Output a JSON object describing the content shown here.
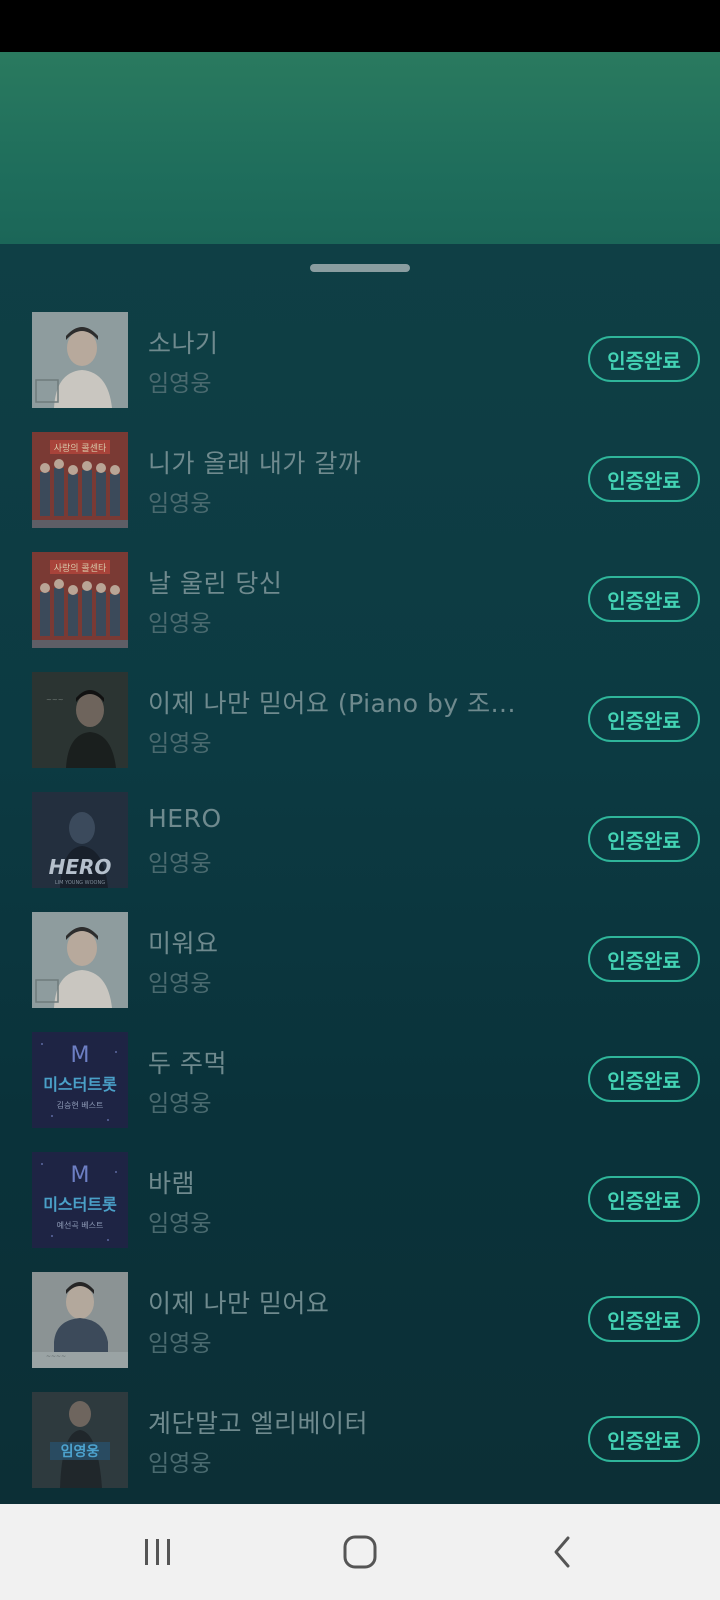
{
  "sheet": {
    "verify_label": "인증완료",
    "songs": [
      {
        "title": "소나기",
        "artist": "임영웅",
        "art": "portrait-light"
      },
      {
        "title": "니가 올래 내가 갈까",
        "artist": "임영웅",
        "art": "group-red"
      },
      {
        "title": "날 울린 당신",
        "artist": "임영웅",
        "art": "group-red"
      },
      {
        "title": "이제 나만 믿어요 (Piano by 조...",
        "artist": "임영웅",
        "art": "portrait-dark"
      },
      {
        "title": "HERO",
        "artist": "임영웅",
        "art": "hero-blue"
      },
      {
        "title": "미워요",
        "artist": "임영웅",
        "art": "portrait-light"
      },
      {
        "title": "두 주먹",
        "artist": "임영웅",
        "art": "mr-trot",
        "art_text": "미스터트롯",
        "art_sub": "김승현 베스트"
      },
      {
        "title": "바램",
        "artist": "임영웅",
        "art": "mr-trot",
        "art_text": "미스터트롯",
        "art_sub": "예선곡 베스트"
      },
      {
        "title": "이제 나만 믿어요",
        "artist": "임영웅",
        "art": "portrait-suit"
      },
      {
        "title": "계단말고 엘리베이터",
        "artist": "임영웅",
        "art": "portrait-stage",
        "art_text": "임영웅"
      }
    ]
  },
  "thumb_text": {
    "group_red": "사랑의 콜센타",
    "hero": "HERO",
    "hero_sub": "LIM YOUNG WOONG",
    "mr_trot_letter": "M"
  },
  "nav": {
    "recents": "recents-icon",
    "home": "home-icon",
    "back": "back-icon"
  },
  "colors": {
    "accent": "#43d3b4",
    "sheet_bg": "#0c3a42",
    "top_bg": "#2a7a5f"
  }
}
